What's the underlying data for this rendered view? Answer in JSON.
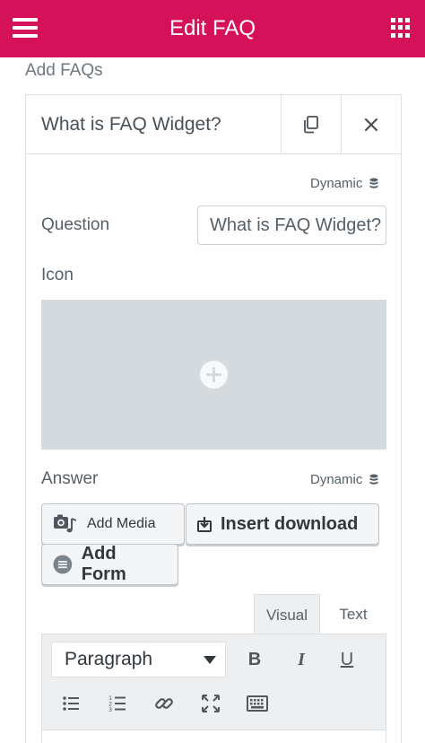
{
  "header": {
    "title": "Edit FAQ",
    "menu_icon": "hamburger-icon",
    "apps_icon": "grid-icon",
    "background": "#d5115a"
  },
  "section": {
    "title": "Add FAQs"
  },
  "faq_item": {
    "title": "What is FAQ Widget?",
    "duplicate_icon": "copy-icon",
    "remove_icon": "close-icon"
  },
  "fields": {
    "dynamic_label": "Dynamic",
    "dynamic_icon": "database-icon",
    "question_label": "Question",
    "question_value": "What is FAQ Widget?",
    "icon_label": "Icon",
    "icon_picker_icon": "plus-circle-icon",
    "answer_label": "Answer"
  },
  "answer_buttons": {
    "add_media": "Add Media",
    "insert_download": "Insert download",
    "add_form": "Add Form"
  },
  "editor": {
    "tabs": [
      "Visual",
      "Text"
    ],
    "active_tab": "Visual",
    "format_value": "Paragraph",
    "toolbar_row1": [
      "bold-icon",
      "italic-icon",
      "underline-icon"
    ],
    "toolbar_row2": [
      "bullet-list-icon",
      "numbered-list-icon",
      "link-icon",
      "fullscreen-icon",
      "keyboard-icon"
    ],
    "bold_glyph": "B",
    "italic_glyph": "I",
    "underline_glyph": "U"
  }
}
